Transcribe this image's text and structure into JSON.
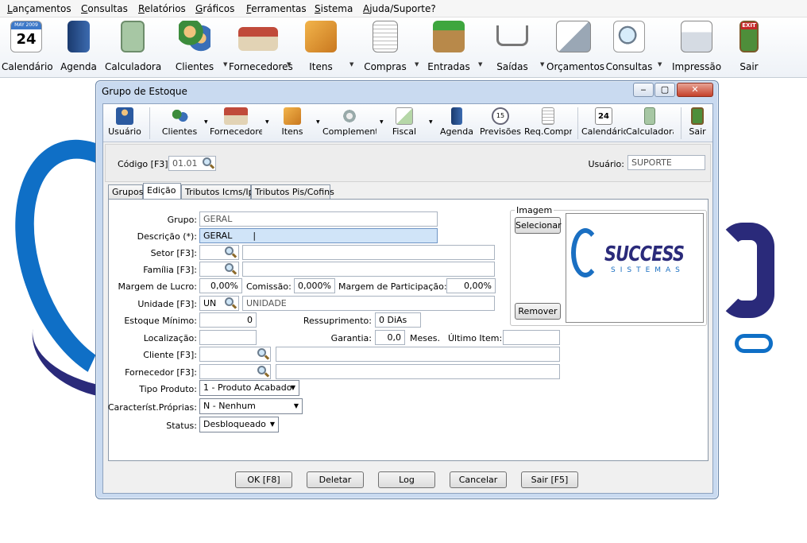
{
  "menubar": {
    "items": [
      "Lançamentos",
      "Consultas",
      "Relatórios",
      "Gráficos",
      "Ferramentas",
      "Sistema",
      "Ajuda/Suporte?"
    ]
  },
  "toolbar": {
    "calendar_badge": "MAY 2009",
    "calendar_day": "24",
    "items": [
      "Calendário",
      "Agenda",
      "Calculadora",
      "Clientes",
      "Fornecedores",
      "Itens",
      "Compras",
      "Entradas",
      "Saídas",
      "Orçamentos",
      "Consultas",
      "Impressão",
      "Sair"
    ],
    "exit_sign": "EXIT"
  },
  "background_logo": {
    "primary": "#0f6fc6",
    "secondary": "#2a2a7a"
  },
  "dialog": {
    "title": "Grupo de Estoque",
    "window_buttons": {
      "minimize": "‒",
      "maximize": "▢",
      "close": "✕"
    },
    "toolbar": {
      "items": [
        "Usuário",
        "Clientes",
        "Fornecedores",
        "Itens",
        "Complementos",
        "Fiscal",
        "Agenda",
        "Previsões",
        "Req.Compr",
        "Calendário",
        "Calculadora",
        "Sair"
      ],
      "calendar_day": "24",
      "previsoes_number": "15"
    },
    "header": {
      "codigo_label": "Código [F3]:",
      "codigo_value": "01.01",
      "usuario_label": "Usuário:",
      "usuario_value": "SUPORTE"
    },
    "tabs": [
      "Grupos",
      "Edição",
      "Tributos Icms/Ipi",
      "Tributos Pis/Cofins"
    ],
    "form": {
      "grupo_label": "Grupo:",
      "grupo_value": "GERAL",
      "descricao_label": "Descrição (*):",
      "descricao_value": "GERAL",
      "setor_label": "Setor [F3]:",
      "familia_label": "Família [F3]:",
      "margem_lucro_label": "Margem de Lucro:",
      "margem_lucro_value": "0,00%",
      "comissao_label": "Comissão:",
      "comissao_value": "0,000%",
      "margem_part_label": "Margem de Participação:",
      "margem_part_value": "0,00%",
      "unidade_label": "Unidade [F3]:",
      "unidade_code": "UN",
      "unidade_desc": "UNIDADE",
      "estoque_min_label": "Estoque Mínimo:",
      "estoque_min_value": "0",
      "ressup_label": "Ressuprimento:",
      "ressup_value": "0 DiAs",
      "localizacao_label": "Localização:",
      "garantia_label": "Garantia:",
      "garantia_value": "0,0",
      "meses_label": "Meses.",
      "ultimo_item_label": "Último Item:",
      "cliente_label": "Cliente [F3]:",
      "fornecedor_label": "Fornecedor [F3]:",
      "tipo_produto_label": "Tipo Produto:",
      "tipo_produto_value": "1 - Produto Acabado",
      "caract_label": "Característ.Próprias:",
      "caract_value": "N - Nenhum",
      "status_label": "Status:",
      "status_value": "Desbloqueado"
    },
    "image_panel": {
      "legend": "Imagem",
      "select_button": "Selecionar",
      "remove_button": "Remover",
      "logo_text": "SUCCESS",
      "logo_subtext": "SISTEMAS"
    },
    "buttons": [
      "OK [F8]",
      "Deletar",
      "Log",
      "Cancelar",
      "Sair [F5]"
    ]
  }
}
